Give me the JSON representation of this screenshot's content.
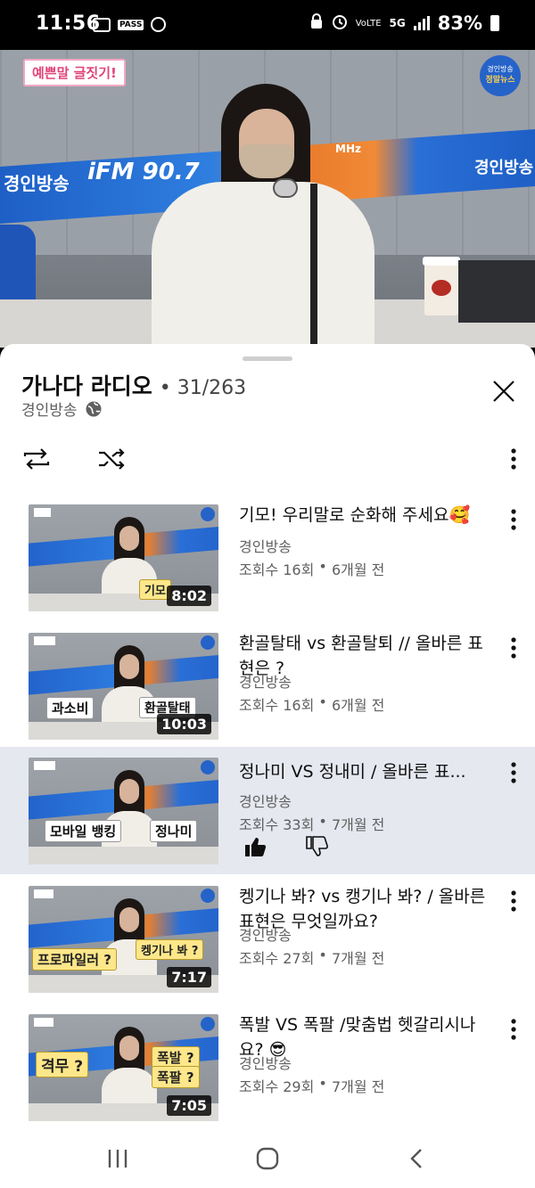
{
  "status_bar": {
    "time": "11:56",
    "pass_label": "PASS",
    "network": "5G",
    "volte": "VoLTE",
    "battery": "83%"
  },
  "player": {
    "corner_tag": "예쁜말 글짓기!",
    "logo_line1": "경인방송",
    "logo_line2": "정말뉴스",
    "banner_left": "경인방송",
    "banner_brand": "iFM 90.7",
    "banner_unit": "MHz",
    "banner_right": "경인방송"
  },
  "playlist": {
    "title": "가나다 라디오",
    "separator": "•",
    "position": "31/263",
    "channel": "경인방송"
  },
  "videos": [
    {
      "title": "기모! 우리말로 순화해 주세요🥰",
      "channel": "경인방송",
      "views": "조회수 16회",
      "age": "6개월 전",
      "duration": "8:02",
      "thumb_caption_1": "기모",
      "thumb_caption_2": "",
      "active": false
    },
    {
      "title": "환골탈태 vs 환골탈퇴 // 올바른 표현은 ?",
      "channel": "경인방송",
      "views": "조회수 16회",
      "age": "6개월 전",
      "duration": "10:03",
      "thumb_caption_1": "과소비",
      "thumb_caption_2": "환골탈태",
      "active": false
    },
    {
      "title": "정나미 VS 정내미 / 올바른 표...",
      "channel": "경인방송",
      "views": "조회수 33회",
      "age": "7개월 전",
      "duration": "",
      "thumb_caption_1": "모바일 뱅킹",
      "thumb_caption_2": "정나미",
      "active": true
    },
    {
      "title": "켕기나 봐? vs 캥기나 봐? / 올바른 표현은 무엇일까요?",
      "channel": "경인방송",
      "views": "조회수 27회",
      "age": "7개월 전",
      "duration": "7:17",
      "thumb_caption_1": "프로파일러 ?",
      "thumb_caption_2": "켕기나 봐 ?",
      "active": false
    },
    {
      "title": "폭발 VS 폭팔  /맞춤법 헷갈리시나요? 😎",
      "channel": "경인방송",
      "views": "조회수 29회",
      "age": "7개월 전",
      "duration": "7:05",
      "thumb_caption_1": "격무 ?",
      "thumb_caption_2": "폭발 ?",
      "thumb_caption_3": "폭팔 ?",
      "active": false
    }
  ],
  "meta_separator": " • ",
  "colors": {
    "active_row": "#e6e8f0",
    "text_primary": "#0f0f0f",
    "text_secondary": "#606060"
  }
}
